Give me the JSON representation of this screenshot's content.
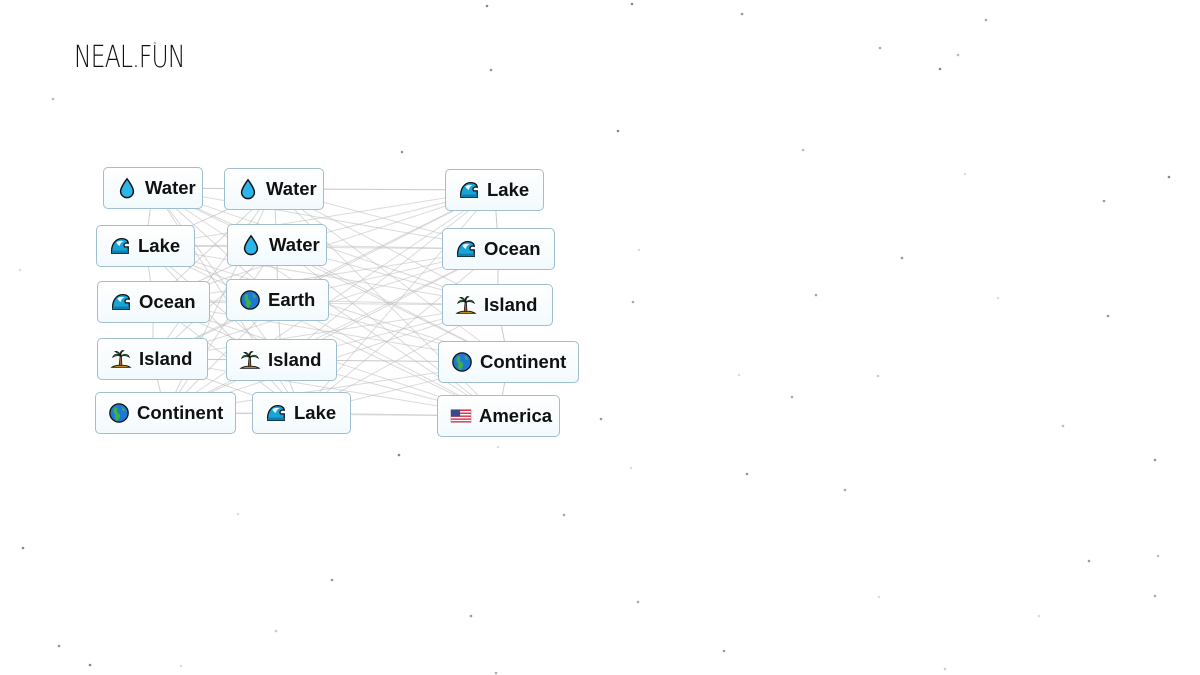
{
  "logo": "NEAL.FUN",
  "items": [
    {
      "label": "Water",
      "icon": "water-drop-icon"
    },
    {
      "label": "Water",
      "icon": "water-drop-icon"
    },
    {
      "label": "Lake",
      "icon": "wave-icon"
    },
    {
      "label": "Lake",
      "icon": "wave-icon"
    },
    {
      "label": "Water",
      "icon": "water-drop-icon"
    },
    {
      "label": "Ocean",
      "icon": "wave-icon"
    },
    {
      "label": "Ocean",
      "icon": "wave-icon"
    },
    {
      "label": "Earth",
      "icon": "earth-globe-icon"
    },
    {
      "label": "Island",
      "icon": "palm-island-icon"
    },
    {
      "label": "Island",
      "icon": "palm-island-icon"
    },
    {
      "label": "Island",
      "icon": "palm-island-icon"
    },
    {
      "label": "Continent",
      "icon": "earth-globe-icon"
    },
    {
      "label": "Continent",
      "icon": "earth-globe-icon"
    },
    {
      "label": "Lake",
      "icon": "wave-icon"
    },
    {
      "label": "America",
      "icon": "us-flag-icon"
    }
  ]
}
